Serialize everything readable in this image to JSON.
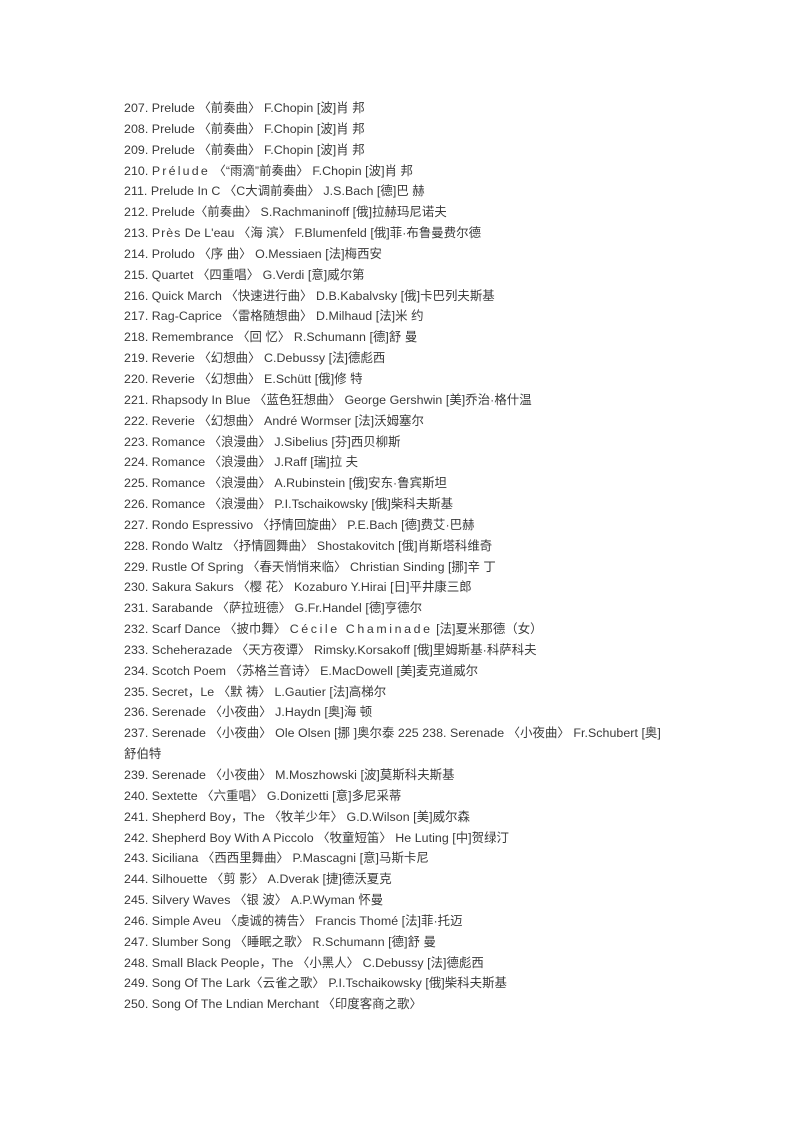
{
  "page": {
    "background_color": "#ffffff",
    "text_color": "#3a3a3a",
    "type": "music-index-listing"
  },
  "entries": [
    {
      "text": "207. Prelude 〈前奏曲〉 F.Chopin [波]肖 邦"
    },
    {
      "text": "208. Prelude 〈前奏曲〉 F.Chopin [波]肖 邦"
    },
    {
      "text": "209. Prelude 〈前奏曲〉 F.Chopin [波]肖 邦"
    },
    {
      "text": "210. Prélude 〈“雨滴”前奏曲〉 F.Chopin [波]肖 邦"
    },
    {
      "text": "211. Prelude In C 〈C大调前奏曲〉 J.S.Bach [德]巴 赫"
    },
    {
      "text": "212. Prelude〈前奏曲〉 S.Rachmaninoff [俄]拉赫玛尼诺夫"
    },
    {
      "text": "213. Près De L'eau 〈海 滨〉 F.Blumenfeld [俄]菲·布鲁曼费尔德"
    },
    {
      "text": "214. Proludo 〈序 曲〉 O.Messiaen [法]梅西安"
    },
    {
      "text": "215. Quartet 〈四重唱〉 G.Verdi [意]威尔第"
    },
    {
      "text": "216. Quick March 〈快速进行曲〉 D.B.Kabalvsky [俄]卡巴列夫斯基"
    },
    {
      "text": "217. Rag-Caprice 〈雷格随想曲〉 D.Milhaud [法]米 约"
    },
    {
      "text": "218. Remembrance 〈回 忆〉 R.Schumann [德]舒 曼"
    },
    {
      "text": "219. Reverie 〈幻想曲〉 C.Debussy [法]德彪西"
    },
    {
      "text": "220. Reverie 〈幻想曲〉 E.Schütt [俄]修 特"
    },
    {
      "text": "221. Rhapsody In Blue 〈蓝色狂想曲〉 George Gershwin [美]乔治·格什温"
    },
    {
      "text": "222. Reverie 〈幻想曲〉 André Wormser [法]沃姆塞尔"
    },
    {
      "text": "223. Romance 〈浪漫曲〉 J.Sibelius [芬]西贝柳斯"
    },
    {
      "text": "224. Romance 〈浪漫曲〉 J.Raff [瑞]拉 夫"
    },
    {
      "text": "225. Romance 〈浪漫曲〉 A.Rubinstein [俄]安东·鲁宾斯坦"
    },
    {
      "text": "226. Romance 〈浪漫曲〉 P.I.Tschaikowsky [俄]柴科夫斯基"
    },
    {
      "text": "227. Rondo Espressivo 〈抒情回旋曲〉 P.E.Bach [德]费艾·巴赫"
    },
    {
      "text": "228. Rondo Waltz 〈抒情圆舞曲〉 Shostakovitch [俄]肖斯塔科维奇"
    },
    {
      "text": "229. Rustle Of Spring 〈春天悄悄来临〉 Christian Sinding [挪]辛 丁"
    },
    {
      "text": "230. Sakura Sakurs 〈樱 花〉 Kozaburo Y.Hirai [日]平井康三郎"
    },
    {
      "text": "231. Sarabande 〈萨拉班德〉 G.Fr.Handel [德]亨德尔"
    },
    {
      "text": "232. Scarf Dance 〈披巾舞〉 Cécile Chaminade [法]夏米那德（女）"
    },
    {
      "text": "233. Scheherazade 〈天方夜谭〉 Rimsky.Korsakoff [俄]里姆斯基·科萨科夫"
    },
    {
      "text": "234. Scotch Poem 〈苏格兰音诗〉 E.MacDowell [美]麦克道威尔"
    },
    {
      "text": "235. Secret，Le 〈默 祷〉 L.Gautier [法]高梯尔"
    },
    {
      "text": "236. Serenade 〈小夜曲〉 J.Haydn [奥]海 顿"
    },
    {
      "text": "237. Serenade 〈小夜曲〉 Ole Olsen [挪 ]奥尔泰 225 238. Serenade 〈小夜曲〉 Fr.Schubert [奥]舒伯特"
    },
    {
      "text": "239. Serenade 〈小夜曲〉 M.Moszhowski [波]莫斯科夫斯基"
    },
    {
      "text": "240. Sextette 〈六重唱〉 G.Donizetti [意]多尼采蒂"
    },
    {
      "text": "241. Shepherd Boy，The 〈牧羊少年〉 G.D.Wilson [美]威尔森"
    },
    {
      "text": "242. Shepherd Boy With A Piccolo 〈牧童短笛〉 He Luting [中]贺绿汀"
    },
    {
      "text": "243. Siciliana 〈西西里舞曲〉 P.Mascagni [意]马斯卡尼"
    },
    {
      "text": "244. Silhouette 〈剪 影〉 A.Dverak [捷]德沃夏克"
    },
    {
      "text": "245. Silvery Waves 〈银 波〉 A.P.Wyman 怀曼"
    },
    {
      "text": "246. Simple Aveu 〈虔诚的祷告〉 Francis Thomé [法]菲·托迈"
    },
    {
      "text": "247. Slumber Song 〈睡眠之歌〉 R.Schumann [德]舒 曼"
    },
    {
      "text": "248. Small Black People，The 〈小黑人〉 C.Debussy [法]德彪西"
    },
    {
      "text": "249. Song Of The Lark〈云雀之歌〉 P.I.Tschaikowsky [俄]柴科夫斯基"
    },
    {
      "text": "250. Song Of The Lndian Merchant 〈印度客商之歌〉"
    }
  ]
}
